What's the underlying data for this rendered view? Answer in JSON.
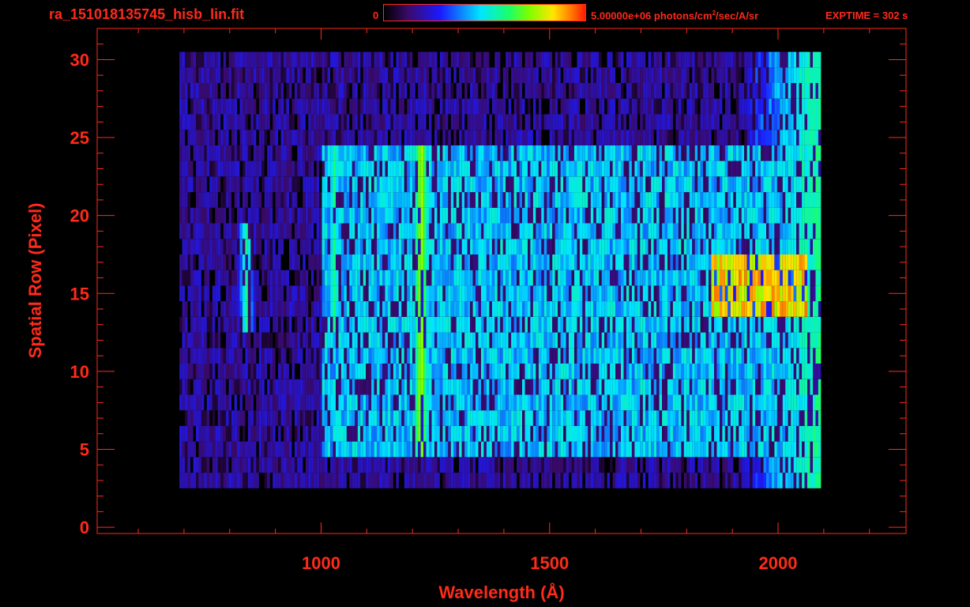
{
  "header": {
    "file_title": "ra_151018135745_hisb_lin.fit",
    "colorbar_min": "0",
    "colorbar_max_prefix": "5.00000e+06 photons/cm",
    "colorbar_max_exp": "2",
    "colorbar_max_suffix": "/sec/A/sr",
    "exptime": "EXPTIME = 302 s"
  },
  "colors": {
    "axis": "#ff2a1a",
    "background": "#000000",
    "colormap": [
      "#000000",
      "#3a0a6a",
      "#1a1aff",
      "#00e5ff",
      "#19ff6a",
      "#7cff00",
      "#ffe600",
      "#ff7a00",
      "#ff1a00"
    ]
  },
  "chart_data": {
    "type": "heatmap",
    "title": "ra_151018135745_hisb_lin.fit",
    "xlabel": "Wavelength (Å)",
    "ylabel": "Spatial Row (Pixel)",
    "xlim": [
      510,
      2280
    ],
    "ylim": [
      -0.4,
      32
    ],
    "x_ticks": [
      1000,
      1500,
      2000
    ],
    "y_ticks": [
      0,
      5,
      10,
      15,
      20,
      25,
      30
    ],
    "colorbar_range": [
      0,
      5000000
    ],
    "colorbar_units": "photons/cm^2/sec/A/sr",
    "colormap": "rainbow",
    "data_x_range": [
      690,
      2090
    ],
    "data_row_range": [
      3,
      30
    ],
    "features": [
      {
        "type": "emission_line",
        "x": 1216,
        "rows": [
          5,
          24
        ],
        "level": 0.65
      },
      {
        "type": "emission_line",
        "x": 1026,
        "rows": [
          13,
          24
        ],
        "level": 0.45
      },
      {
        "type": "emission_line",
        "x": 1304,
        "rows": [
          13,
          22
        ],
        "level": 0.4
      },
      {
        "type": "emission_line",
        "x": 834,
        "rows": [
          13,
          19
        ],
        "level": 0.45
      },
      {
        "type": "bright_band",
        "rows": [
          13,
          24
        ],
        "x_range": [
          1000,
          2060
        ],
        "level": 0.4
      },
      {
        "type": "bright_band",
        "rows": [
          5,
          13
        ],
        "x_range": [
          1000,
          2060
        ],
        "level": 0.4
      },
      {
        "type": "bright_band",
        "rows": [
          14,
          17
        ],
        "x_range": [
          1850,
          2060
        ],
        "level": 0.85
      }
    ]
  }
}
